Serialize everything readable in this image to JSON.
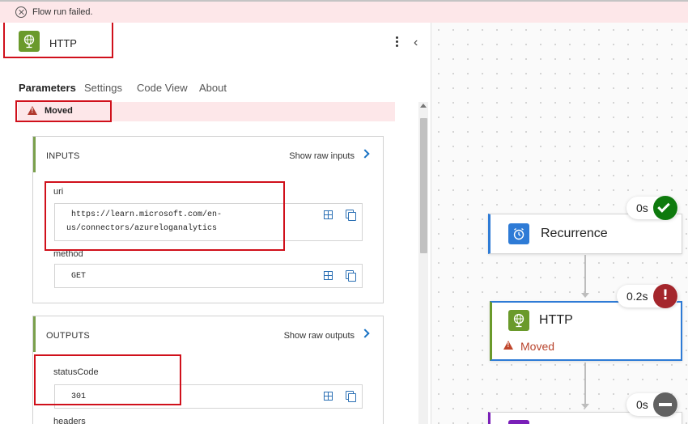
{
  "banner": {
    "message": "Flow run failed.",
    "icon": "error-circle-icon"
  },
  "panel": {
    "title": "HTTP",
    "action_icon": "http-globe-icon",
    "tabs": [
      {
        "label": "Parameters",
        "active": true
      },
      {
        "label": "Settings",
        "active": false
      },
      {
        "label": "Code View",
        "active": false
      },
      {
        "label": "About",
        "active": false
      }
    ],
    "status_label": "Moved",
    "inputs": {
      "title": "INPUTS",
      "raw_link": "Show raw inputs",
      "fields": [
        {
          "label": "uri",
          "value_line1": "https://learn.microsoft.com/en-",
          "value_line2": "us/connectors/azureloganalytics"
        },
        {
          "label": "method",
          "value": "GET"
        }
      ]
    },
    "outputs": {
      "title": "OUTPUTS",
      "raw_link": "Show raw outputs",
      "fields": [
        {
          "label": "statusCode",
          "value": "301"
        },
        {
          "label": "headers"
        }
      ]
    }
  },
  "canvas": {
    "nodes": [
      {
        "title": "Recurrence",
        "duration": "0s",
        "status": "succeeded",
        "icon": "alarm-clock-icon",
        "accent": "#2e7bd6"
      },
      {
        "title": "HTTP",
        "duration": "0.2s",
        "status": "failed",
        "status_text": "Moved",
        "icon": "http-globe-icon",
        "accent": "#6a9a2b"
      },
      {
        "title": "",
        "duration": "0s",
        "status": "skipped",
        "accent": "#7a1fb8"
      }
    ]
  },
  "colors": {
    "error_bg": "#fde7e9",
    "success": "#0e7a0d",
    "failure": "#a4262c",
    "skipped": "#616161",
    "highlight_box": "#d0101b",
    "link_blue": "#1a73c4"
  }
}
